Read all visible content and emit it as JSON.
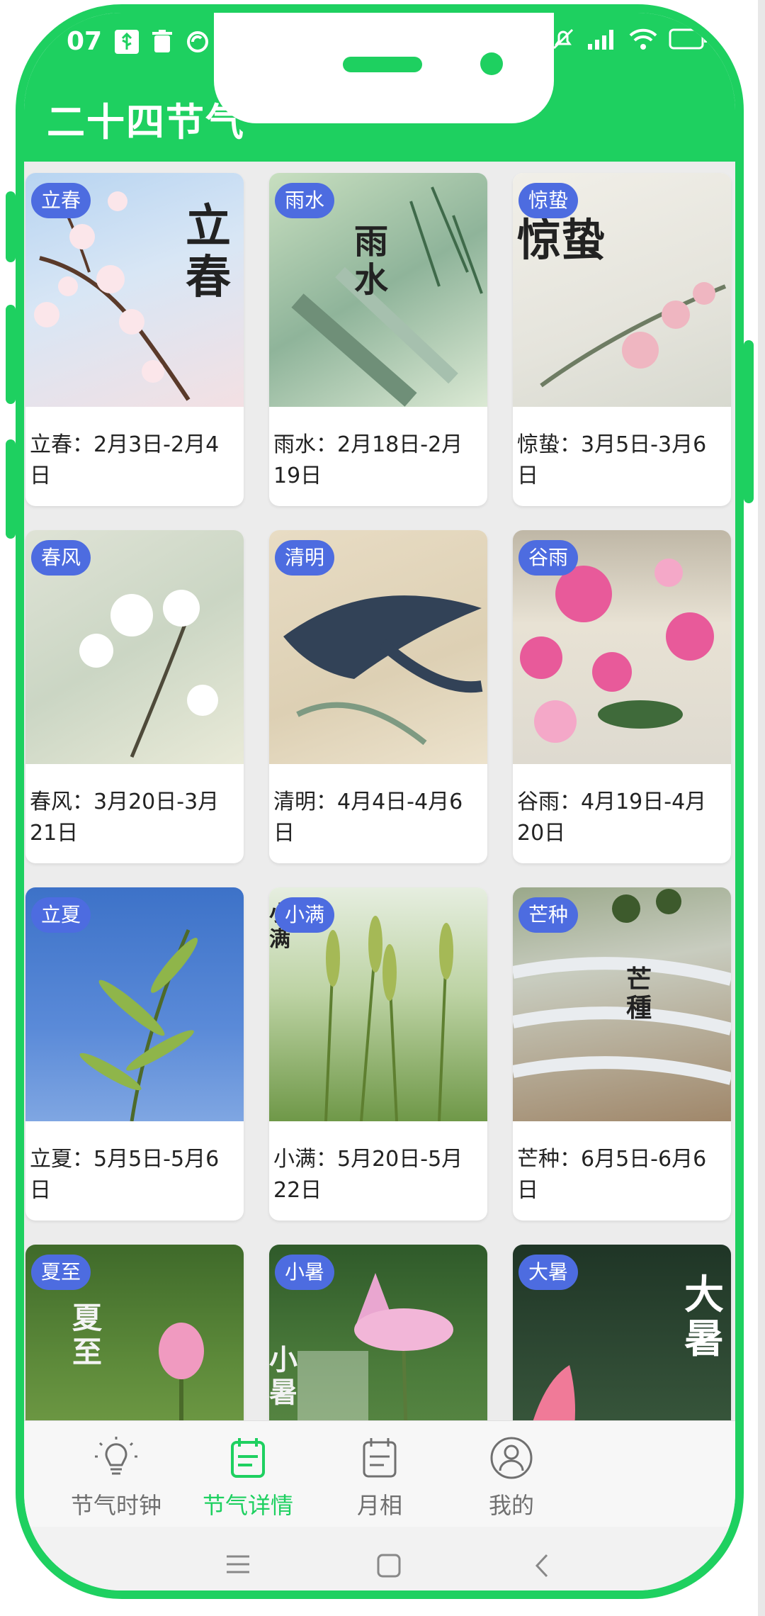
{
  "status": {
    "time": "07"
  },
  "app": {
    "title": "二十四节气"
  },
  "cards": [
    {
      "badge": "立春",
      "text": "立春：2月3日-2月4日",
      "img_text": "立春"
    },
    {
      "badge": "雨水",
      "text": "雨水：2月18日-2月19日",
      "img_text": "雨水"
    },
    {
      "badge": "惊蛰",
      "text": "惊蛰：3月5日-3月6日",
      "img_text": "惊蛰"
    },
    {
      "badge": "春风",
      "text": "春风：3月20日-3月21日",
      "img_text": ""
    },
    {
      "badge": "清明",
      "text": "清明：4月4日-4月6日",
      "img_text": ""
    },
    {
      "badge": "谷雨",
      "text": "谷雨：4月19日-4月20日",
      "img_text": ""
    },
    {
      "badge": "立夏",
      "text": "立夏：5月5日-5月6日",
      "img_text": ""
    },
    {
      "badge": "小满",
      "text": "小满：5月20日-5月22日",
      "img_text": "小满"
    },
    {
      "badge": "芒种",
      "text": "芒种：6月5日-6月6日",
      "img_text": "芒種"
    },
    {
      "badge": "夏至",
      "text": "",
      "img_text": "夏至"
    },
    {
      "badge": "小暑",
      "text": "",
      "img_text": "小暑"
    },
    {
      "badge": "大暑",
      "text": "",
      "img_text": "大暑"
    }
  ],
  "nav": [
    {
      "label": "节气时钟",
      "icon": "bulb-icon",
      "active": false
    },
    {
      "label": "节气详情",
      "icon": "calendar-icon",
      "active": true
    },
    {
      "label": "月相",
      "icon": "calendar-icon",
      "active": false
    },
    {
      "label": "我的",
      "icon": "user-icon",
      "active": false
    }
  ],
  "colors": {
    "primary": "#1ed060",
    "badge": "#4d6ce0",
    "inactive": "#707070"
  }
}
